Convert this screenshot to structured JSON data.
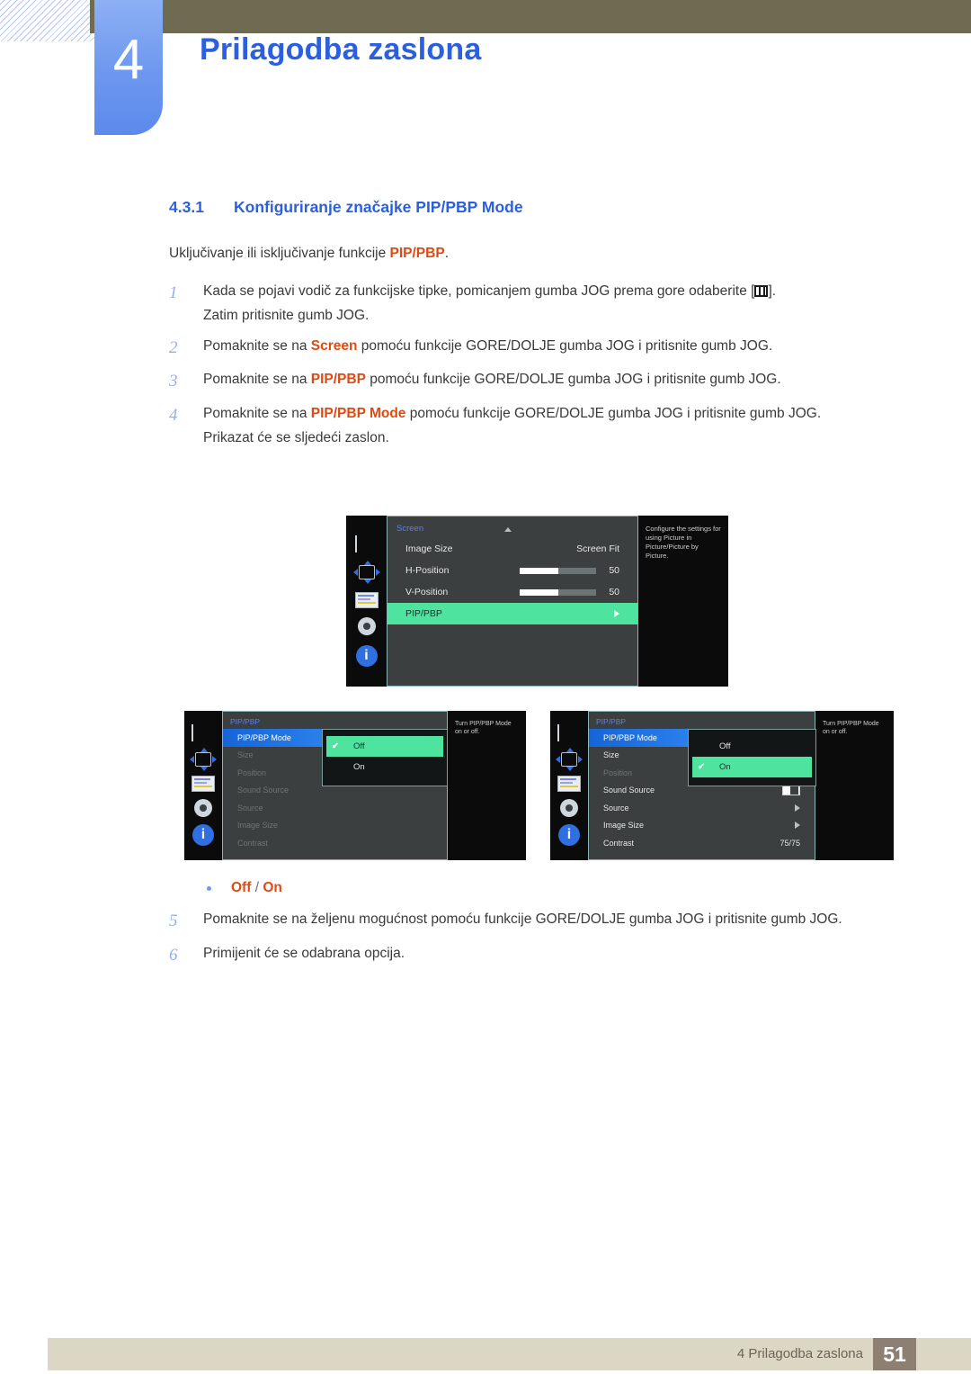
{
  "header": {
    "chapter_number": "4",
    "chapter_title": "Prilagodba zaslona"
  },
  "section": {
    "number": "4.3.1",
    "title": "Konfiguriranje značajke PIP/PBP Mode",
    "intro_before": "Uključivanje ili isključivanje funkcije ",
    "intro_keyword": "PIP/PBP",
    "intro_after": "."
  },
  "steps": [
    {
      "index": "1",
      "parts": [
        {
          "t": "Kada se pojavi vodič za funkcijske tipke, pomicanjem gumba JOG prema gore odaberite [",
          "k": false
        },
        {
          "t": "KEYCAP",
          "k": "icon"
        },
        {
          "t": "].",
          "k": false
        }
      ],
      "extra": "Zatim pritisnite gumb JOG."
    },
    {
      "index": "2",
      "parts": [
        {
          "t": "Pomaknite se na ",
          "k": false
        },
        {
          "t": "Screen",
          "k": true
        },
        {
          "t": " pomoću funkcije GORE/DOLJE gumba JOG i pritisnite gumb JOG.",
          "k": false
        }
      ],
      "extra": ""
    },
    {
      "index": "3",
      "parts": [
        {
          "t": "Pomaknite se na ",
          "k": false
        },
        {
          "t": "PIP/PBP",
          "k": true
        },
        {
          "t": " pomoću funkcije GORE/DOLJE gumba JOG i pritisnite gumb JOG.",
          "k": false
        }
      ],
      "extra": ""
    },
    {
      "index": "4",
      "parts": [
        {
          "t": "Pomaknite se na ",
          "k": false
        },
        {
          "t": "PIP/PBP Mode",
          "k": true
        },
        {
          "t": " pomoću funkcije GORE/DOLJE gumba JOG i pritisnite gumb JOG.",
          "k": false
        }
      ],
      "extra": "Prikazat će se sljedeći zaslon."
    }
  ],
  "bullet": {
    "off": "Off",
    "separator": " / ",
    "on": "On"
  },
  "steps2": [
    {
      "index": "5",
      "parts": [
        {
          "t": "Pomaknite se na željenu mogućnost pomoću funkcije GORE/DOLJE gumba JOG i pritisnite gumb JOG.",
          "k": false
        }
      ],
      "extra": ""
    },
    {
      "index": "6",
      "parts": [
        {
          "t": "Primijenit će se odabrana opcija.",
          "k": false
        }
      ],
      "extra": ""
    }
  ],
  "osd_top": {
    "rail_icons": [
      "monitor-icon",
      "move-icon",
      "osd-lines-icon",
      "gear-icon",
      "info-icon"
    ],
    "menu_title": "Screen",
    "rows": [
      {
        "label": "Image Size",
        "value": "Screen Fit",
        "type": "value"
      },
      {
        "label": "H-Position",
        "value": "50",
        "type": "slider",
        "fill_pct": 50
      },
      {
        "label": "V-Position",
        "value": "50",
        "type": "slider",
        "fill_pct": 50
      },
      {
        "label": "PIP/PBP",
        "value": "",
        "type": "arrow",
        "highlight": "green"
      }
    ],
    "help_text": "Configure the settings for using Picture in Picture/Picture by Picture."
  },
  "osd_left": {
    "menu_title": "PIP/PBP",
    "rows": [
      {
        "label": "PIP/PBP Mode",
        "value": "",
        "highlight": "blue"
      },
      {
        "label": "Size",
        "value": "",
        "dim": true
      },
      {
        "label": "Position",
        "value": "",
        "dim": true
      },
      {
        "label": "Sound Source",
        "value": "",
        "dim": true
      },
      {
        "label": "Source",
        "value": "",
        "dim": true
      },
      {
        "label": "Image Size",
        "value": "",
        "dim": true
      },
      {
        "label": "Contrast",
        "value": "",
        "dim": true
      }
    ],
    "popup_options": [
      {
        "label": "Off",
        "selected": true
      },
      {
        "label": "On",
        "selected": false
      }
    ],
    "help_text": "Turn PIP/PBP Mode on or off."
  },
  "osd_right": {
    "menu_title": "PIP/PBP",
    "rows": [
      {
        "label": "PIP/PBP Mode",
        "value": "",
        "highlight": "blue"
      },
      {
        "label": "Size",
        "value": ""
      },
      {
        "label": "Position",
        "value": "",
        "dim": true
      },
      {
        "label": "Sound Source",
        "value": "",
        "type": "pbp-icon"
      },
      {
        "label": "Source",
        "value": "",
        "type": "arrow"
      },
      {
        "label": "Image Size",
        "value": "",
        "type": "arrow"
      },
      {
        "label": "Contrast",
        "value": "75/75",
        "type": "value"
      }
    ],
    "popup_options": [
      {
        "label": "Off",
        "selected": false
      },
      {
        "label": "On",
        "selected": true
      }
    ],
    "help_text": "Turn PIP/PBP Mode on or off."
  },
  "footer": {
    "text": "4 Prilagodba zaslona",
    "page": "51"
  },
  "colors": {
    "accent_blue": "#2b5fdd",
    "keyword_orange": "#e04a12",
    "olive": "#6f6b52",
    "footer_bg": "#dcd6c4",
    "page_box": "#8d7f72",
    "osd_green": "#4fe3a0",
    "osd_blue": "#2f86f0"
  }
}
